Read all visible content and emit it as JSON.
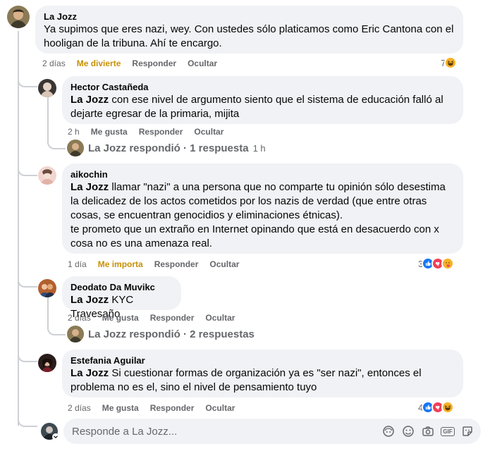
{
  "comments": [
    {
      "author": "La Jozz",
      "text": "Ya supimos que eres nazi, wey. Con ustedes sólo platicamos como Eric Cantona con el hooligan de la tribuna. Ahí te encargo.",
      "time": "2 días",
      "reaction_label": "Me divierte",
      "reply_label": "Responder",
      "hide_label": "Ocultar",
      "reaction_count": "7",
      "reaction_icons": [
        "haha"
      ]
    },
    {
      "author": "Hector Castañeda",
      "mention": "La Jozz",
      "text": " con ese nivel de argumento siento que el sistema de educación falló al dejarte egresar de la primaria, mijita",
      "time": "2 h",
      "reaction_label": "Me gusta",
      "reply_label": "Responder",
      "hide_label": "Ocultar",
      "replies_summary": "La Jozz respondió · 1 respuesta",
      "replies_time": "1 h"
    },
    {
      "author": "aikochin",
      "mention": "La Jozz",
      "text_line1": " llamar \"nazi\" a una persona que no comparte tu opinión sólo desestima la delicadez de los actos cometidos por los nazis de verdad (que entre otras cosas, se encuentran genocidios y eliminaciones étnicas).",
      "text_line2": "te prometo que un extraño en Internet opinando que está en desacuerdo con x cosa no es una amenaza real.",
      "time": "1 día",
      "reaction_label": "Me importa",
      "reply_label": "Responder",
      "hide_label": "Ocultar",
      "reaction_count": "3",
      "reaction_icons": [
        "like",
        "love",
        "care"
      ]
    },
    {
      "author": "Deodato Da Muvikc",
      "mention": "La Jozz",
      "text": " KYC Travesaño",
      "time": "2 días",
      "reaction_label": "Me gusta",
      "reply_label": "Responder",
      "hide_label": "Ocultar",
      "replies_summary": "La Jozz respondió · 2 respuestas"
    },
    {
      "author": "Estefania Aguilar",
      "mention": "La Jozz",
      "text": " Si cuestionar formas de organización ya es \"ser nazi\", entonces el problema no es el, sino el nivel de pensamiento tuyo",
      "time": "2 días",
      "reaction_label": "Me gusta",
      "reply_label": "Responder",
      "hide_label": "Ocultar",
      "reaction_count": "4",
      "reaction_icons": [
        "like",
        "love",
        "haha"
      ]
    }
  ],
  "composer": {
    "placeholder": "Responde a La Jozz...",
    "gif_label": "GIF"
  },
  "colors": {
    "bubble": "#f0f2f5",
    "meta": "#65676b",
    "haha_label": "#c79006",
    "like": "#1877f2",
    "love": "#f33e58"
  }
}
